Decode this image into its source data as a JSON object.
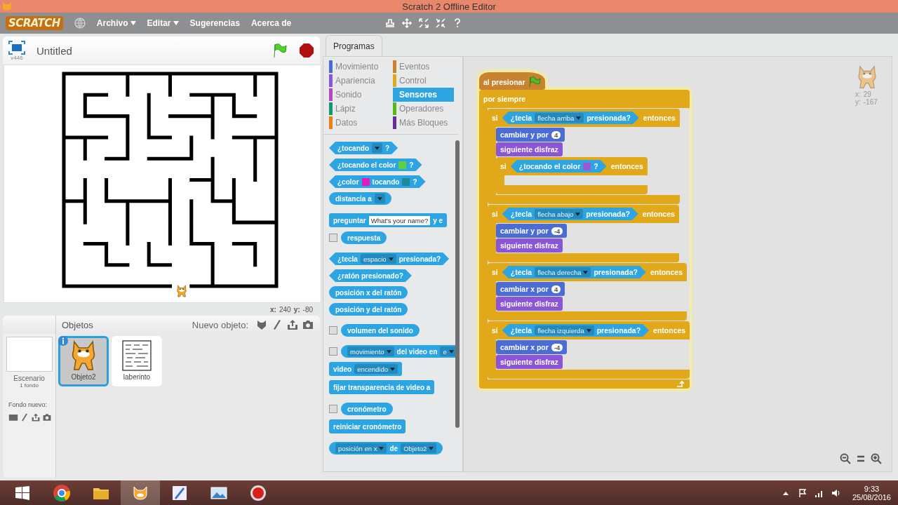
{
  "window": {
    "title": "Scratch 2 Offline Editor"
  },
  "menu_bar": {
    "logo": "SCRATCH",
    "items": [
      {
        "label": "Archivo",
        "has_menu": true
      },
      {
        "label": "Editar",
        "has_menu": true
      },
      {
        "label": "Sugerencias",
        "has_menu": false
      },
      {
        "label": "Acerca de",
        "has_menu": false
      }
    ]
  },
  "stage": {
    "title": "Untitled",
    "version": "v446",
    "mouse_position": [
      {
        "label": "x:",
        "value": "240"
      },
      {
        "label": "y:",
        "value": "-80"
      }
    ]
  },
  "sprites_pane": {
    "title": "Objetos",
    "new_sprite_label": "Nuevo objeto:",
    "stage_item": {
      "label": "Escenario",
      "sublabel": "1 fondo"
    },
    "new_backdrop_label": "Fondo nuevo:",
    "sprites": [
      {
        "name": "Objeto2",
        "kind": "cat",
        "selected": true
      },
      {
        "name": "laberinto",
        "kind": "maze",
        "selected": false
      }
    ]
  },
  "palette": {
    "tabs": [
      {
        "label": "Programas",
        "selected": true
      }
    ],
    "categories": [
      {
        "label": "Movimiento",
        "color": "#4a6cd4",
        "selected": false
      },
      {
        "label": "Apariencia",
        "color": "#8a55d7",
        "selected": false
      },
      {
        "label": "Sonido",
        "color": "#bb42c3",
        "selected": false
      },
      {
        "label": "Lápiz",
        "color": "#0e9a6c",
        "selected": false
      },
      {
        "label": "Datos",
        "color": "#ee7d16",
        "selected": false
      },
      {
        "label": "Eventos",
        "color": "#c88330",
        "selected": false
      },
      {
        "label": "Control",
        "color": "#e1a91a",
        "selected": false
      },
      {
        "label": "Sensores",
        "color": "#2ca5e2",
        "selected": true
      },
      {
        "label": "Operadores",
        "color": "#5cb712",
        "selected": false
      },
      {
        "label": "Más Bloques",
        "color": "#632d99",
        "selected": false
      }
    ],
    "block_groups": [
      [
        {
          "kind": "boolean",
          "color": "#2ca5e2",
          "parts": [
            {
              "kind": "text",
              "text": "¿tocando"
            },
            {
              "kind": "dropdown"
            },
            {
              "kind": "text",
              "text": "?"
            }
          ]
        },
        {
          "kind": "boolean",
          "color": "#2ca5e2",
          "parts": [
            {
              "kind": "text",
              "text": "¿tocando el color"
            },
            {
              "kind": "color",
              "color": "#5ed13d"
            },
            {
              "kind": "text",
              "text": "?"
            }
          ]
        },
        {
          "kind": "boolean",
          "color": "#2ca5e2",
          "parts": [
            {
              "kind": "text",
              "text": "¿color"
            },
            {
              "kind": "color",
              "color": "#e619c3"
            },
            {
              "kind": "text",
              "text": "tocando"
            },
            {
              "kind": "color",
              "color": "#1e8c96"
            },
            {
              "kind": "text",
              "text": "?"
            }
          ]
        },
        {
          "kind": "reporter",
          "color": "#2ca5e2",
          "parts": [
            {
              "kind": "text",
              "text": "distancia a"
            },
            {
              "kind": "dropdown"
            }
          ]
        }
      ],
      [
        {
          "kind": "stack",
          "color": "#2ca5e2",
          "parts": [
            {
              "kind": "text",
              "text": "preguntar"
            },
            {
              "kind": "input",
              "text": "What's your name?"
            },
            {
              "kind": "text",
              "text": "y e"
            }
          ]
        },
        {
          "kind": "reporter",
          "color": "#2ca5e2",
          "monitor": {
            "checked": false
          },
          "parts": [
            {
              "kind": "text",
              "text": "respuesta"
            }
          ]
        }
      ],
      [
        {
          "kind": "boolean",
          "color": "#2ca5e2",
          "parts": [
            {
              "kind": "text",
              "text": "¿tecla"
            },
            {
              "kind": "dropdown",
              "text": "espacio"
            },
            {
              "kind": "text",
              "text": "presionada?"
            }
          ]
        },
        {
          "kind": "boolean",
          "color": "#2ca5e2",
          "parts": [
            {
              "kind": "text",
              "text": "¿ratón presionado?"
            }
          ]
        },
        {
          "kind": "reporter",
          "color": "#2ca5e2",
          "parts": [
            {
              "kind": "text",
              "text": "posición x del ratón"
            }
          ]
        },
        {
          "kind": "reporter",
          "color": "#2ca5e2",
          "parts": [
            {
              "kind": "text",
              "text": "posición y del ratón"
            }
          ]
        }
      ],
      [
        {
          "kind": "reporter",
          "color": "#2ca5e2",
          "monitor": {
            "checked": false
          },
          "parts": [
            {
              "kind": "text",
              "text": "volumen del sonido"
            }
          ]
        }
      ],
      [
        {
          "kind": "reporter",
          "color": "#2ca5e2",
          "monitor": {
            "checked": false
          },
          "parts": [
            {
              "kind": "dropdown",
              "text": "movimiento"
            },
            {
              "kind": "text",
              "text": "del video en"
            },
            {
              "kind": "dropdown",
              "text": "e"
            }
          ]
        },
        {
          "kind": "stack",
          "color": "#2ca5e2",
          "parts": [
            {
              "kind": "text",
              "text": "video"
            },
            {
              "kind": "dropdown",
              "text": "encendido"
            }
          ]
        },
        {
          "kind": "stack",
          "color": "#2ca5e2",
          "parts": [
            {
              "kind": "text",
              "text": "fijar transparencia de video a"
            }
          ]
        }
      ],
      [
        {
          "kind": "reporter",
          "color": "#2ca5e2",
          "monitor": {
            "checked": false
          },
          "parts": [
            {
              "kind": "text",
              "text": "cronómetro"
            }
          ]
        },
        {
          "kind": "stack",
          "color": "#2ca5e2",
          "parts": [
            {
              "kind": "text",
              "text": "reiniciar cronómetro"
            }
          ]
        }
      ],
      [
        {
          "kind": "reporter",
          "color": "#2ca5e2",
          "parts": [
            {
              "kind": "dropdown",
              "text": "posición en x"
            },
            {
              "kind": "text",
              "text": "de"
            },
            {
              "kind": "dropdown",
              "text": "Objeto2"
            }
          ]
        }
      ]
    ]
  },
  "scripts": {
    "sprite_info": [
      {
        "label": "x:",
        "value": "29"
      },
      {
        "label": "y:",
        "value": "-167"
      }
    ],
    "running": true,
    "blocks": [
      {
        "kind": "hat",
        "color": "#c88330",
        "parts": [
          {
            "kind": "text",
            "text": "al presionar"
          },
          {
            "kind": "flag"
          }
        ]
      },
      {
        "kind": "forever",
        "color": "#e1a91a",
        "parts": [
          {
            "kind": "text",
            "text": "por siempre"
          }
        ],
        "children": [
          {
            "kind": "if",
            "color": "#e1a91a",
            "parts": [
              {
                "kind": "text",
                "text": "si"
              },
              {
                "kind": "boolean",
                "color": "#2ca5e2",
                "parts": [
                  {
                    "kind": "text",
                    "text": "¿tecla"
                  },
                  {
                    "kind": "dropdown",
                    "text": "flecha arriba"
                  },
                  {
                    "kind": "text",
                    "text": "presionada?"
                  }
                ]
              },
              {
                "kind": "text",
                "text": "entonces"
              }
            ],
            "children": [
              {
                "kind": "stack",
                "color": "#4a6cd4",
                "parts": [
                  {
                    "kind": "text",
                    "text": "cambiar y por"
                  },
                  {
                    "kind": "number",
                    "text": "4"
                  }
                ]
              },
              {
                "kind": "stack",
                "color": "#8a55d7",
                "parts": [
                  {
                    "kind": "text",
                    "text": "siguiente disfraz"
                  }
                ]
              },
              {
                "kind": "if",
                "color": "#e1a91a",
                "parts": [
                  {
                    "kind": "text",
                    "text": "si"
                  },
                  {
                    "kind": "boolean",
                    "color": "#2ca5e2",
                    "parts": [
                      {
                        "kind": "text",
                        "text": "¿tocando el color"
                      },
                      {
                        "kind": "color",
                        "color": "#9b59d9"
                      },
                      {
                        "kind": "text",
                        "text": "?"
                      }
                    ]
                  },
                  {
                    "kind": "text",
                    "text": "entonces"
                  }
                ]
              }
            ]
          },
          {
            "kind": "if",
            "color": "#e1a91a",
            "parts": [
              {
                "kind": "text",
                "text": "si"
              },
              {
                "kind": "boolean",
                "color": "#2ca5e2",
                "parts": [
                  {
                    "kind": "text",
                    "text": "¿tecla"
                  },
                  {
                    "kind": "dropdown",
                    "text": "flecha abajo"
                  },
                  {
                    "kind": "text",
                    "text": "presionada?"
                  }
                ]
              },
              {
                "kind": "text",
                "text": "entonces"
              }
            ],
            "children": [
              {
                "kind": "stack",
                "color": "#4a6cd4",
                "parts": [
                  {
                    "kind": "text",
                    "text": "cambiar y por"
                  },
                  {
                    "kind": "number",
                    "text": "-4"
                  }
                ]
              },
              {
                "kind": "stack",
                "color": "#8a55d7",
                "parts": [
                  {
                    "kind": "text",
                    "text": "siguiente disfraz"
                  }
                ]
              }
            ]
          },
          {
            "kind": "if",
            "color": "#e1a91a",
            "parts": [
              {
                "kind": "text",
                "text": "si"
              },
              {
                "kind": "boolean",
                "color": "#2ca5e2",
                "parts": [
                  {
                    "kind": "text",
                    "text": "¿tecla"
                  },
                  {
                    "kind": "dropdown",
                    "text": "flecha derecha"
                  },
                  {
                    "kind": "text",
                    "text": "presionada?"
                  }
                ]
              },
              {
                "kind": "text",
                "text": "entonces"
              }
            ],
            "children": [
              {
                "kind": "stack",
                "color": "#4a6cd4",
                "parts": [
                  {
                    "kind": "text",
                    "text": "cambiar x por"
                  },
                  {
                    "kind": "number",
                    "text": "4"
                  }
                ]
              },
              {
                "kind": "stack",
                "color": "#8a55d7",
                "parts": [
                  {
                    "kind": "text",
                    "text": "siguiente disfraz"
                  }
                ]
              }
            ]
          },
          {
            "kind": "if",
            "color": "#e1a91a",
            "parts": [
              {
                "kind": "text",
                "text": "si"
              },
              {
                "kind": "boolean",
                "color": "#2ca5e2",
                "parts": [
                  {
                    "kind": "text",
                    "text": "¿tecla"
                  },
                  {
                    "kind": "dropdown",
                    "text": "flecha izquierda"
                  },
                  {
                    "kind": "text",
                    "text": "presionada?"
                  }
                ]
              },
              {
                "kind": "text",
                "text": "entonces"
              }
            ],
            "children": [
              {
                "kind": "stack",
                "color": "#4a6cd4",
                "parts": [
                  {
                    "kind": "text",
                    "text": "cambiar x por"
                  },
                  {
                    "kind": "number",
                    "text": "-4"
                  }
                ]
              },
              {
                "kind": "stack",
                "color": "#8a55d7",
                "parts": [
                  {
                    "kind": "text",
                    "text": "siguiente disfraz"
                  }
                ]
              }
            ]
          }
        ]
      }
    ]
  },
  "taskbar": {
    "apps": [
      {
        "kind": "chrome",
        "active": false
      },
      {
        "kind": "folder",
        "active": false
      },
      {
        "kind": "scratch",
        "active": true
      },
      {
        "kind": "paint",
        "active": false
      },
      {
        "kind": "picture",
        "active": false
      },
      {
        "kind": "record",
        "active": false
      }
    ],
    "time": "9:33",
    "date": "25/08/2016"
  }
}
